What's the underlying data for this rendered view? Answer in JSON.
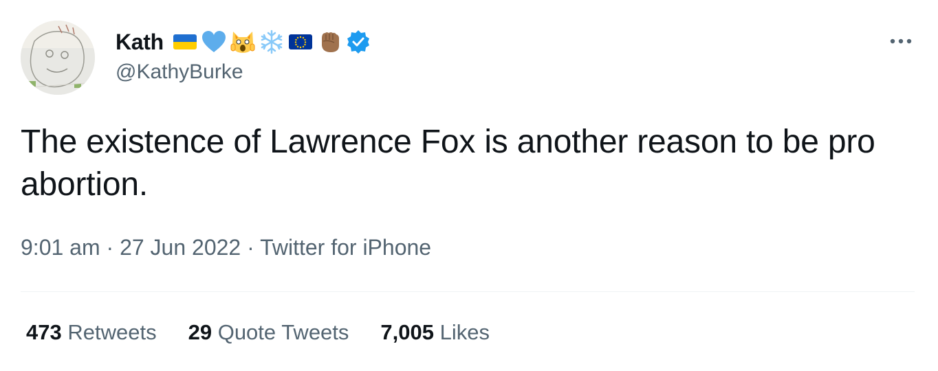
{
  "author": {
    "display_name": "Kath",
    "handle": "@KathyBurke",
    "name_emojis": [
      "ukraine-flag-icon",
      "blue-heart-icon",
      "screaming-cat-icon",
      "snowflake-icon",
      "eu-flag-icon",
      "raised-fist-icon"
    ],
    "verified": true
  },
  "tweet": {
    "text": "The existence of Lawrence Fox is another reason to be pro abortion.",
    "time": "9:01 am",
    "date": "27 Jun 2022",
    "source": "Twitter for iPhone",
    "separator": " · "
  },
  "stats": {
    "retweets": {
      "count": "473",
      "label": "Retweets"
    },
    "quote_tweets": {
      "count": "29",
      "label": "Quote Tweets"
    },
    "likes": {
      "count": "7,005",
      "label": "Likes"
    }
  },
  "colors": {
    "text_primary": "#0f1419",
    "text_secondary": "#536471",
    "verified_blue": "#1d9bf0",
    "divider": "#eff3f4"
  }
}
